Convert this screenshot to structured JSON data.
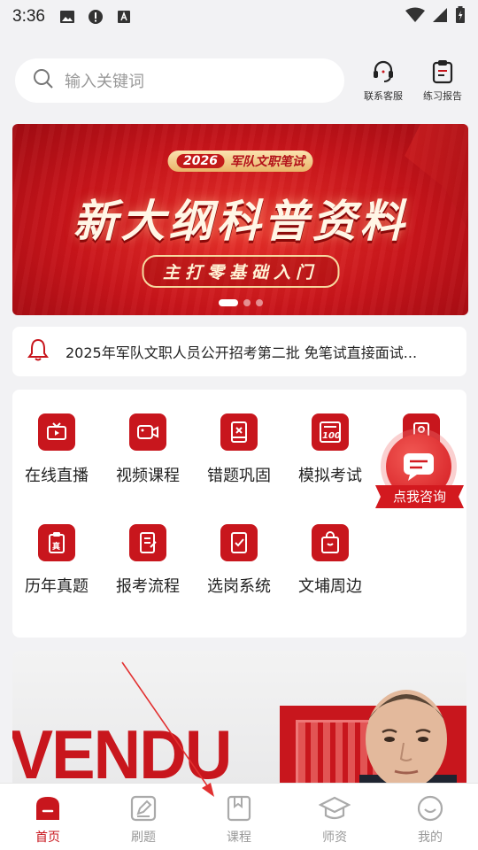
{
  "status_bar": {
    "time": "3:36"
  },
  "search": {
    "placeholder": "输入关键词"
  },
  "top_actions": [
    {
      "label": "联系客服",
      "icon": "headset-icon"
    },
    {
      "label": "练习报告",
      "icon": "report-icon"
    }
  ],
  "banner": {
    "badge_year": "2026",
    "badge_text": "军队文职笔试",
    "headline": "新大纲科普资料",
    "subline": "主打零基础入门",
    "slides": 3,
    "active_slide": 1
  },
  "notice": {
    "text": "2025年军队文职人员公开招考第二批 免笔试直接面试..."
  },
  "features": [
    {
      "label": "在线直播",
      "icon": "live-tv-icon"
    },
    {
      "label": "视频课程",
      "icon": "video-camera-icon"
    },
    {
      "label": "错题巩固",
      "icon": "wrong-book-icon"
    },
    {
      "label": "模拟考试",
      "icon": "score-100-icon"
    },
    {
      "label": "",
      "icon": "exam-paper-icon"
    },
    {
      "label": "历年真题",
      "icon": "past-papers-icon"
    },
    {
      "label": "报考流程",
      "icon": "process-doc-icon"
    },
    {
      "label": "选岗系统",
      "icon": "checklist-icon"
    },
    {
      "label": "文埔周边",
      "icon": "shopping-bag-icon"
    }
  ],
  "consult": {
    "label": "点我咨询"
  },
  "promo": {
    "word": "VENDU"
  },
  "tabs": [
    {
      "label": "首页",
      "active": true
    },
    {
      "label": "刷题",
      "active": false
    },
    {
      "label": "课程",
      "active": false
    },
    {
      "label": "师资",
      "active": false
    },
    {
      "label": "我的",
      "active": false
    }
  ],
  "colors": {
    "brand": "#c8161d",
    "background": "#f2f2f4",
    "inactive": "#999999"
  }
}
